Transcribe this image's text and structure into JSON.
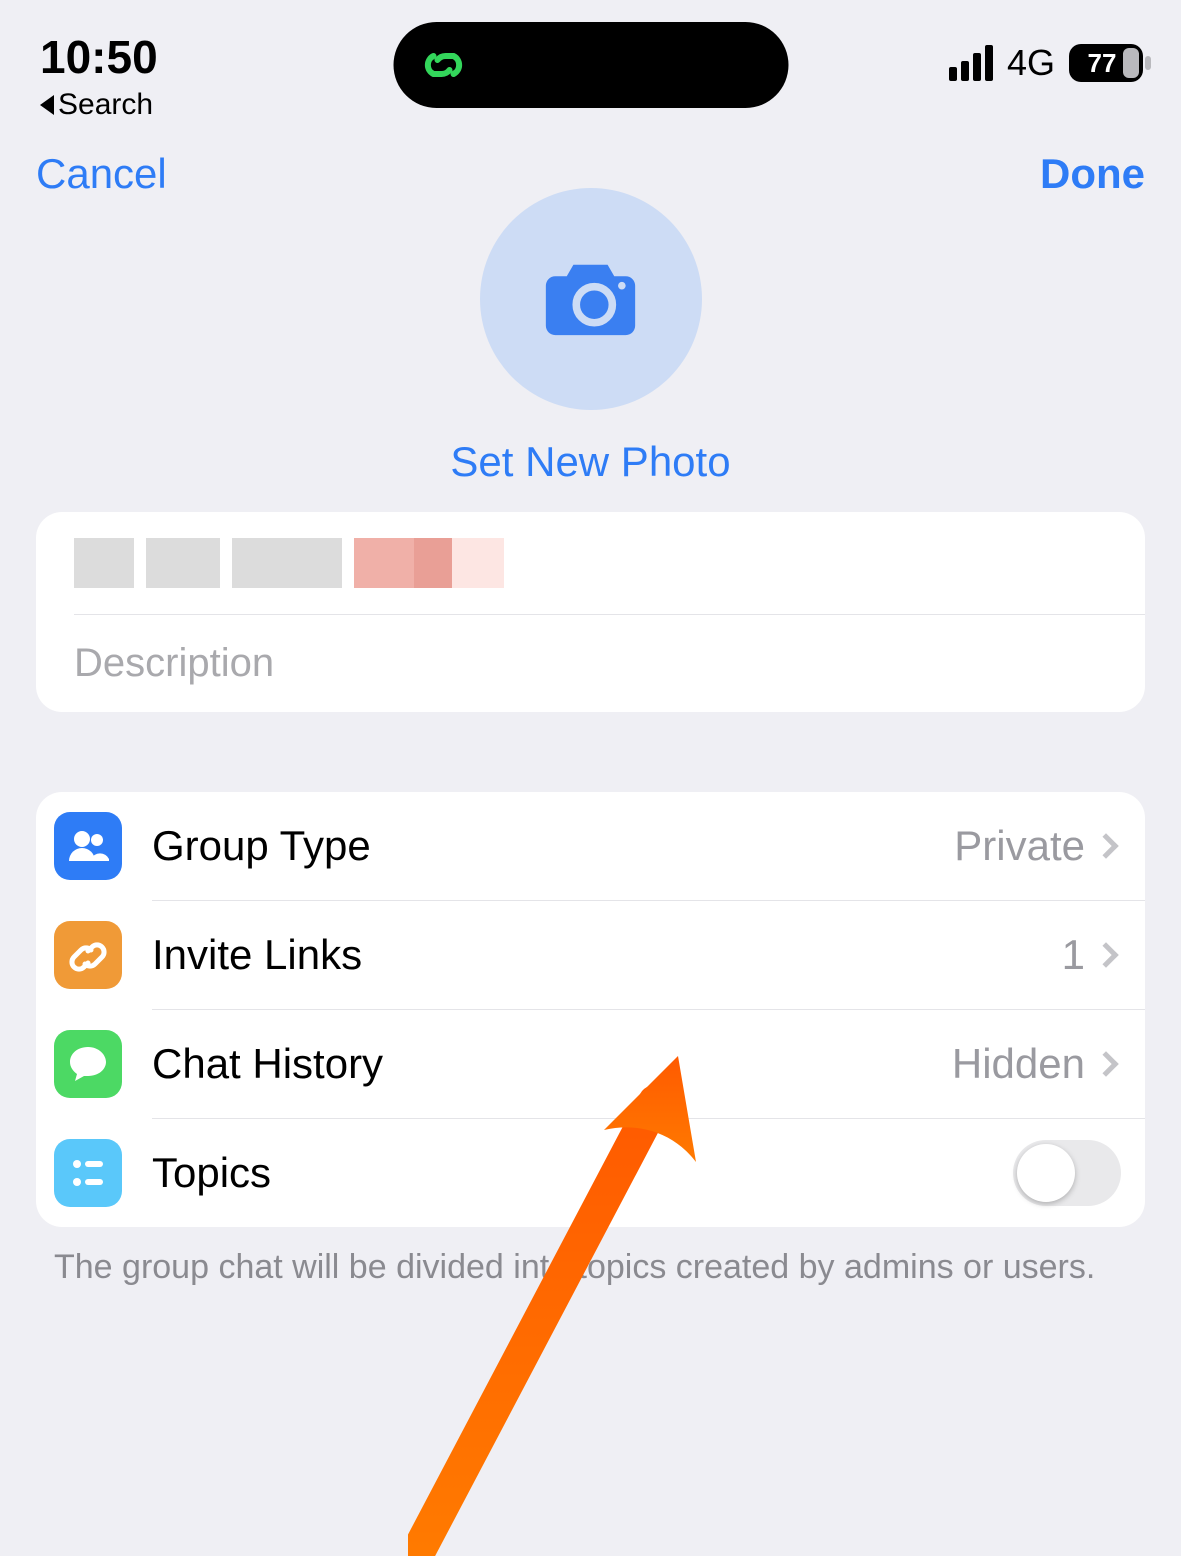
{
  "statusbar": {
    "time": "10:50",
    "back_label": "Search",
    "network": "4G",
    "battery": "77"
  },
  "nav": {
    "cancel": "Cancel",
    "done": "Done"
  },
  "photo": {
    "set_label": "Set New Photo"
  },
  "inputs": {
    "name_value": "",
    "description_placeholder": "Description"
  },
  "settings": {
    "group_type": {
      "label": "Group Type",
      "value": "Private"
    },
    "invite_links": {
      "label": "Invite Links",
      "value": "1"
    },
    "chat_history": {
      "label": "Chat History",
      "value": "Hidden"
    },
    "topics": {
      "label": "Topics"
    }
  },
  "footer": "The group chat will be divided into topics created by admins or users."
}
